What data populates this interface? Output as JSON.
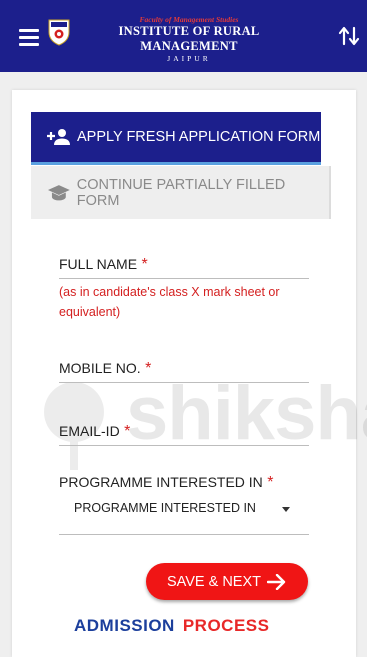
{
  "header": {
    "faculty_text": "Faculty of Management Studies",
    "institute_text": "INSTITUTE OF RURAL MANAGEMENT",
    "city_text": "JAIPUR",
    "menu_icon": "hamburger-icon",
    "sort_icon": "sort-arrows-icon",
    "background_color": "#1c1f8c"
  },
  "tabs": {
    "apply_label": "APPLY FRESH APPLICATION FORM",
    "apply_icon": "add-person-icon",
    "continue_label": "CONTINUE PARTIALLY FILLED FORM",
    "continue_icon": "graduation-cap-icon"
  },
  "form": {
    "full_name_label": "FULL NAME",
    "full_name_hint": "(as in candidate's class X mark sheet or equivalent)",
    "mobile_label": "MOBILE NO.",
    "email_label": "EMAIL-ID",
    "programme_label": "PROGRAMME INTERESTED IN",
    "programme_selected": "PROGRAMME INTERESTED IN",
    "required_mark": "*"
  },
  "actions": {
    "save_label": "SAVE & NEXT",
    "save_color": "#f01515"
  },
  "footer": {
    "admission_word": "ADMISSION",
    "process_word": "PROCESS"
  },
  "watermark": {
    "text": "shiksha"
  }
}
